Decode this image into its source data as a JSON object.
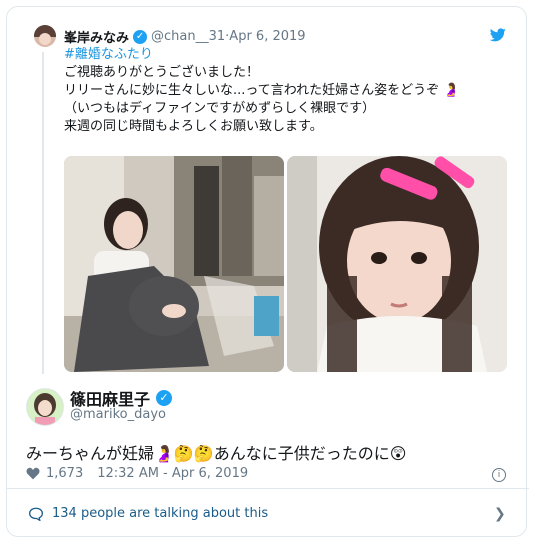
{
  "quoted": {
    "name": "峯岸みなみ",
    "handle": "@chan__31",
    "separator": " · ",
    "date": "Apr 6, 2019",
    "hashtag": "#離婚なふたり",
    "lines": [
      "ご視聴ありがとうございました！",
      "リリーさんに妙に生々しいな...って言われた妊婦さん姿をどうぞ 🤰",
      "（いつもはディファインですがめずらしく裸眼です）",
      "来週の同じ時間もよろしくお願い致します。"
    ]
  },
  "main": {
    "name": "篠田麻里子",
    "handle": "@mariko_dayo",
    "text": "みーちゃんが妊婦🤰🤔🤔あんなに子供だったのに😲",
    "likes": "1,673",
    "timestamp": "12:32 AM - Apr 6, 2019"
  },
  "footer": {
    "talking": "134 people are talking about this"
  },
  "icons": [
    "verified-icon",
    "twitter-bird-icon",
    "heart-icon",
    "info-icon",
    "comment-icon",
    "chevron-right-icon"
  ],
  "colors": {
    "accent": "#1da1f2",
    "muted": "#657786",
    "link": "#1b95e0",
    "heart": "#e0245e"
  }
}
